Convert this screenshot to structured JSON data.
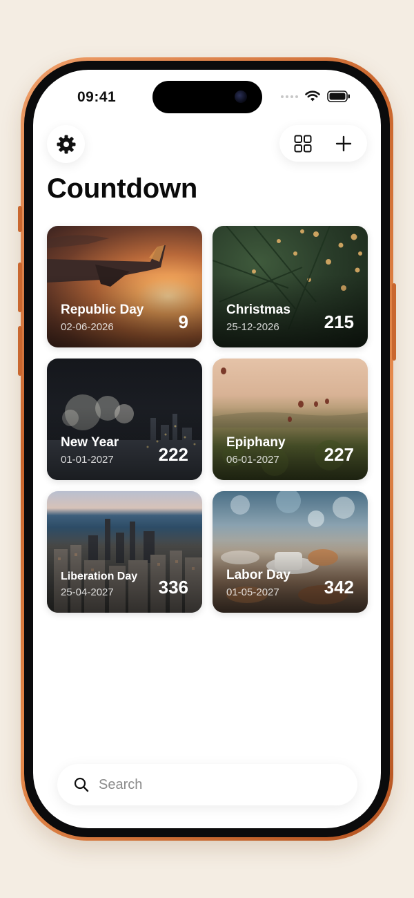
{
  "status_bar": {
    "time": "09:41"
  },
  "toolbar": {
    "settings_icon": "gear-icon",
    "grid_icon": "grid-view-icon",
    "add_icon": "plus-icon"
  },
  "title": "Countdown",
  "events": [
    {
      "name": "Republic Day",
      "date": "02-06-2026",
      "days": "9",
      "image": "airplane-wing-sunset"
    },
    {
      "name": "Christmas",
      "date": "25-12-2026",
      "days": "215",
      "image": "christmas-tree-lights"
    },
    {
      "name": "New Year",
      "date": "01-01-2027",
      "days": "222",
      "image": "fireworks-city-night"
    },
    {
      "name": "Epiphany",
      "date": "06-01-2027",
      "days": "227",
      "image": "hot-air-balloons-valley"
    },
    {
      "name": "Liberation Day",
      "date": "25-04-2027",
      "days": "336",
      "image": "city-skyline-lakefront"
    },
    {
      "name": "Labor Day",
      "date": "01-05-2027",
      "days": "342",
      "image": "breakfast-table-blur"
    }
  ],
  "search": {
    "placeholder": "Search",
    "icon": "search-icon"
  },
  "colors": {
    "background": "#f4ede3",
    "phone_frame": "#c9652c",
    "title_text": "#0a0a0a",
    "placeholder": "#8a8a8a"
  }
}
